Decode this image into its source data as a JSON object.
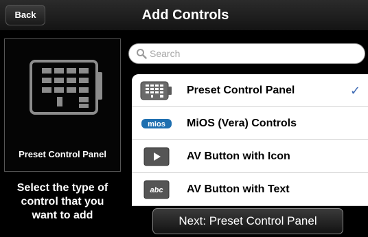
{
  "navbar": {
    "back_label": "Back",
    "title": "Add Controls"
  },
  "left_panel": {
    "preview_label": "Preset Control Panel",
    "instruction_lines": [
      "Select the type of",
      "control that you",
      "want to add"
    ]
  },
  "search": {
    "placeholder": "Search",
    "value": ""
  },
  "list": {
    "items": [
      {
        "label": "Preset Control Panel",
        "icon": "preset-panel-icon",
        "selected": true
      },
      {
        "label": "MiOS (Vera) Controls",
        "icon": "mios-logo-icon",
        "icon_text": "mios",
        "selected": false
      },
      {
        "label": "AV Button with Icon",
        "icon": "play-button-icon",
        "selected": false
      },
      {
        "label": "AV Button with Text",
        "icon": "text-button-icon",
        "icon_text": "abc",
        "selected": false
      }
    ],
    "check_glyph": "✓"
  },
  "next_button": {
    "label": "Next: Preset Control Panel"
  },
  "colors": {
    "checkmark": "#3d6ab4",
    "mios_logo": "#1e6fb0"
  }
}
